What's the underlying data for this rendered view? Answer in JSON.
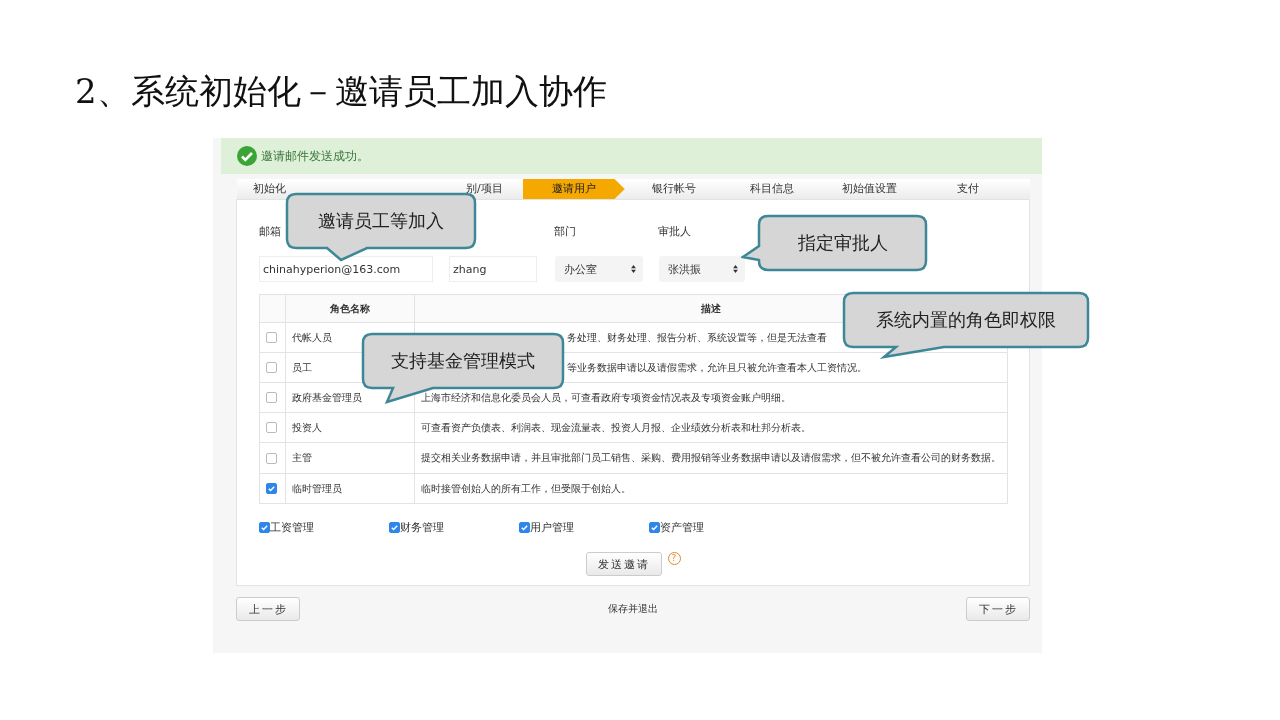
{
  "slide_title": "2、系统初始化－邀请员工加入协作",
  "alert": {
    "message": "邀请邮件发送成功。"
  },
  "steps": [
    {
      "label": "初始化",
      "selected": false
    },
    {
      "label": "别/项目",
      "selected": false
    },
    {
      "label": "邀请用户",
      "selected": true
    },
    {
      "label": "银行帐号",
      "selected": false
    },
    {
      "label": "科目信息",
      "selected": false
    },
    {
      "label": "初始值设置",
      "selected": false
    },
    {
      "label": "支付",
      "selected": false
    }
  ],
  "form": {
    "labels": [
      "邮箱",
      "部门",
      "审批人"
    ],
    "email": "chinahyperion@163.com",
    "name": "zhang",
    "department": "办公室",
    "approver": "张洪振"
  },
  "roles_table": {
    "columns": [
      "角色名称",
      "描述"
    ],
    "rows": [
      {
        "checked": false,
        "name": "代帐人员",
        "description": "务处理、财务处理、报告分析、系统设置等，但是无法查看"
      },
      {
        "checked": false,
        "name": "员工",
        "description": "等业务数据申请以及请假需求，允许且只被允许查看本人工资情况。"
      },
      {
        "checked": false,
        "name": "政府基金管理员",
        "description": "上海市经济和信息化委员会人员，可查看政府专项资金情况表及专项资金账户明细。"
      },
      {
        "checked": false,
        "name": "投资人",
        "description": "可查看资产负债表、利润表、现金流量表、投资人月报、企业绩效分析表和杜邦分析表。"
      },
      {
        "checked": false,
        "name": "主管",
        "description": "提交相关业务数据申请，并且审批部门员工销售、采购、费用报销等业务数据申请以及请假需求，但不被允许查看公司的财务数据。"
      },
      {
        "checked": true,
        "name": "临时管理员",
        "description": "临时接管创始人的所有工作，但受限于创始人。"
      }
    ]
  },
  "modules": [
    {
      "label": "工资管理",
      "checked": true
    },
    {
      "label": "财务管理",
      "checked": true
    },
    {
      "label": "用户管理",
      "checked": true
    },
    {
      "label": "资产管理",
      "checked": true
    }
  ],
  "send_button": "发送邀请",
  "help_icon": "?",
  "footer": {
    "prev_button": "上一步",
    "save_exit": "保存并退出",
    "next_button": "下一步"
  },
  "callouts": [
    {
      "text": "邀请员工等加入"
    },
    {
      "text": "指定审批人"
    },
    {
      "text": "支持基金管理模式"
    },
    {
      "text": "系统内置的角色即权限"
    }
  ]
}
